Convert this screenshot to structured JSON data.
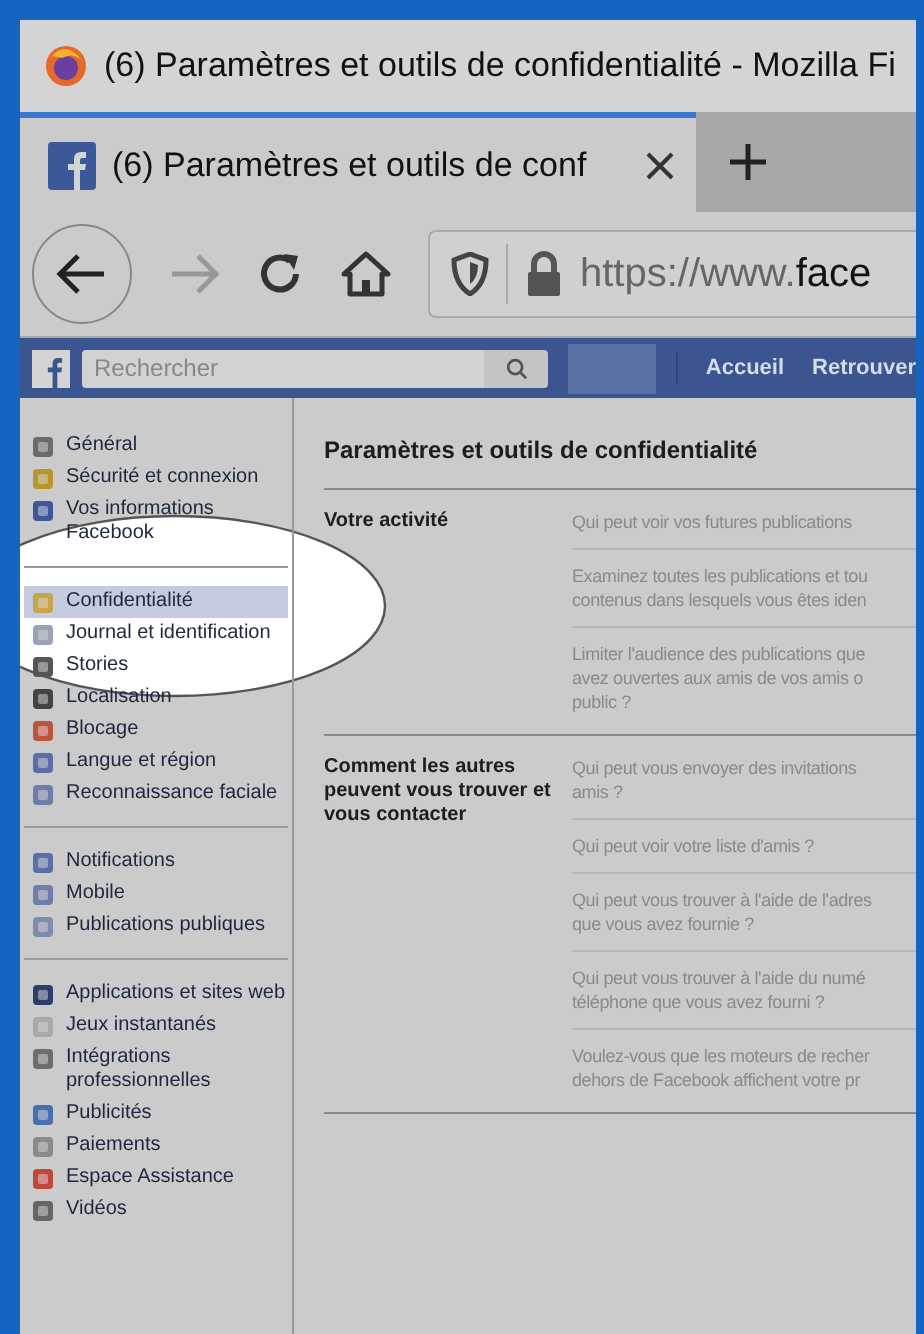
{
  "window": {
    "title": "(6) Paramètres et outils de confidentialité - Mozilla Fi"
  },
  "tabs": [
    {
      "label": "(6) Paramètres et outils de conf",
      "selected": true
    }
  ],
  "address_bar": {
    "url_start": "https://www.",
    "url_host": "face"
  },
  "facebook_bar": {
    "search": {
      "placeholder": "Rechercher"
    },
    "nav": [
      "Accueil",
      "Retrouver"
    ]
  },
  "sidebar": {
    "groups": [
      [
        {
          "label": "Général",
          "selected": false
        },
        {
          "label": "Sécurité et connexion",
          "selected": false
        },
        {
          "label": "Vos informations Facebook",
          "selected": false
        }
      ],
      [
        {
          "label": "Confidentialité",
          "selected": true
        },
        {
          "label": "Journal et identification",
          "selected": false
        },
        {
          "label": "Stories",
          "selected": false
        },
        {
          "label": "Localisation",
          "selected": false
        },
        {
          "label": "Blocage",
          "selected": false
        },
        {
          "label": "Langue et région",
          "selected": false
        },
        {
          "label": "Reconnaissance faciale",
          "selected": false
        }
      ],
      [
        {
          "label": "Notifications",
          "selected": false
        },
        {
          "label": "Mobile",
          "selected": false
        },
        {
          "label": "Publications publiques",
          "selected": false
        }
      ],
      [
        {
          "label": "Applications et sites web",
          "selected": false
        },
        {
          "label": "Jeux instantanés",
          "selected": false
        },
        {
          "label": "Intégrations professionnelles",
          "selected": false
        },
        {
          "label": "Publicités",
          "selected": false
        },
        {
          "label": "Paiements",
          "selected": false
        },
        {
          "label": "Espace Assistance",
          "selected": false
        },
        {
          "label": "Vidéos",
          "selected": false
        }
      ]
    ]
  },
  "main": {
    "title": "Paramètres et outils de confidentialité",
    "sections": [
      {
        "heading": "Votre activité",
        "items": [
          {
            "lines": [
              "Qui peut voir vos futures publications"
            ]
          },
          {
            "lines": [
              "Examinez toutes les publications et tou",
              "contenus dans lesquels vous êtes iden"
            ]
          },
          {
            "lines": [
              "Limiter l'audience des publications que",
              "avez ouvertes aux amis de vos amis o",
              "public ?"
            ]
          }
        ]
      },
      {
        "heading": "Comment les autres peuvent vous trouver et vous contacter",
        "items": [
          {
            "lines": [
              "Qui peut vous envoyer des invitations",
              "amis ?"
            ]
          },
          {
            "lines": [
              "Qui peut voir votre liste d'amis ?"
            ]
          },
          {
            "lines": [
              "Qui peut vous trouver à l'aide de l'adres",
              "que vous avez fournie ?"
            ]
          },
          {
            "lines": [
              "Qui peut vous trouver à l'aide du numé",
              "téléphone que vous avez fourni ?"
            ]
          },
          {
            "lines": [
              "Voulez-vous que les moteurs de recher",
              "dehors de Facebook affichent votre pr"
            ]
          }
        ]
      }
    ]
  }
}
